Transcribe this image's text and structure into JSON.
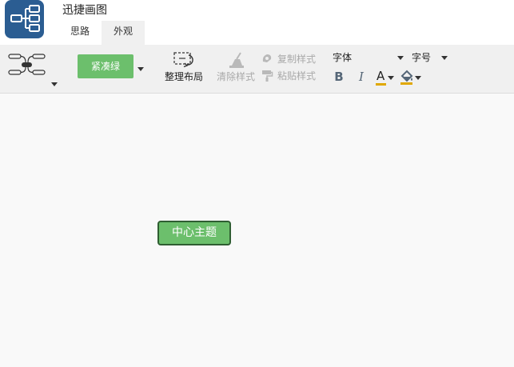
{
  "app": {
    "title": "迅捷画图"
  },
  "tabs": [
    {
      "label": "思路"
    },
    {
      "label": "外观"
    }
  ],
  "toolbar": {
    "theme_label": "紧凑绿",
    "tidy_label": "整理布局",
    "clear_style_label": "清除样式",
    "copy_style_label": "复制样式",
    "paste_style_label": "粘贴样式",
    "font_label": "字体",
    "size_label": "字号",
    "bold_label": "B",
    "italic_label": "I",
    "font_color_label": "A"
  },
  "colors": {
    "theme_green": "#6cbf6c",
    "node_border": "#2f5e32",
    "logo_blue": "#2b5d92",
    "font_color_bar": "#e0a800"
  },
  "canvas": {
    "root_topic": "中心主题"
  }
}
